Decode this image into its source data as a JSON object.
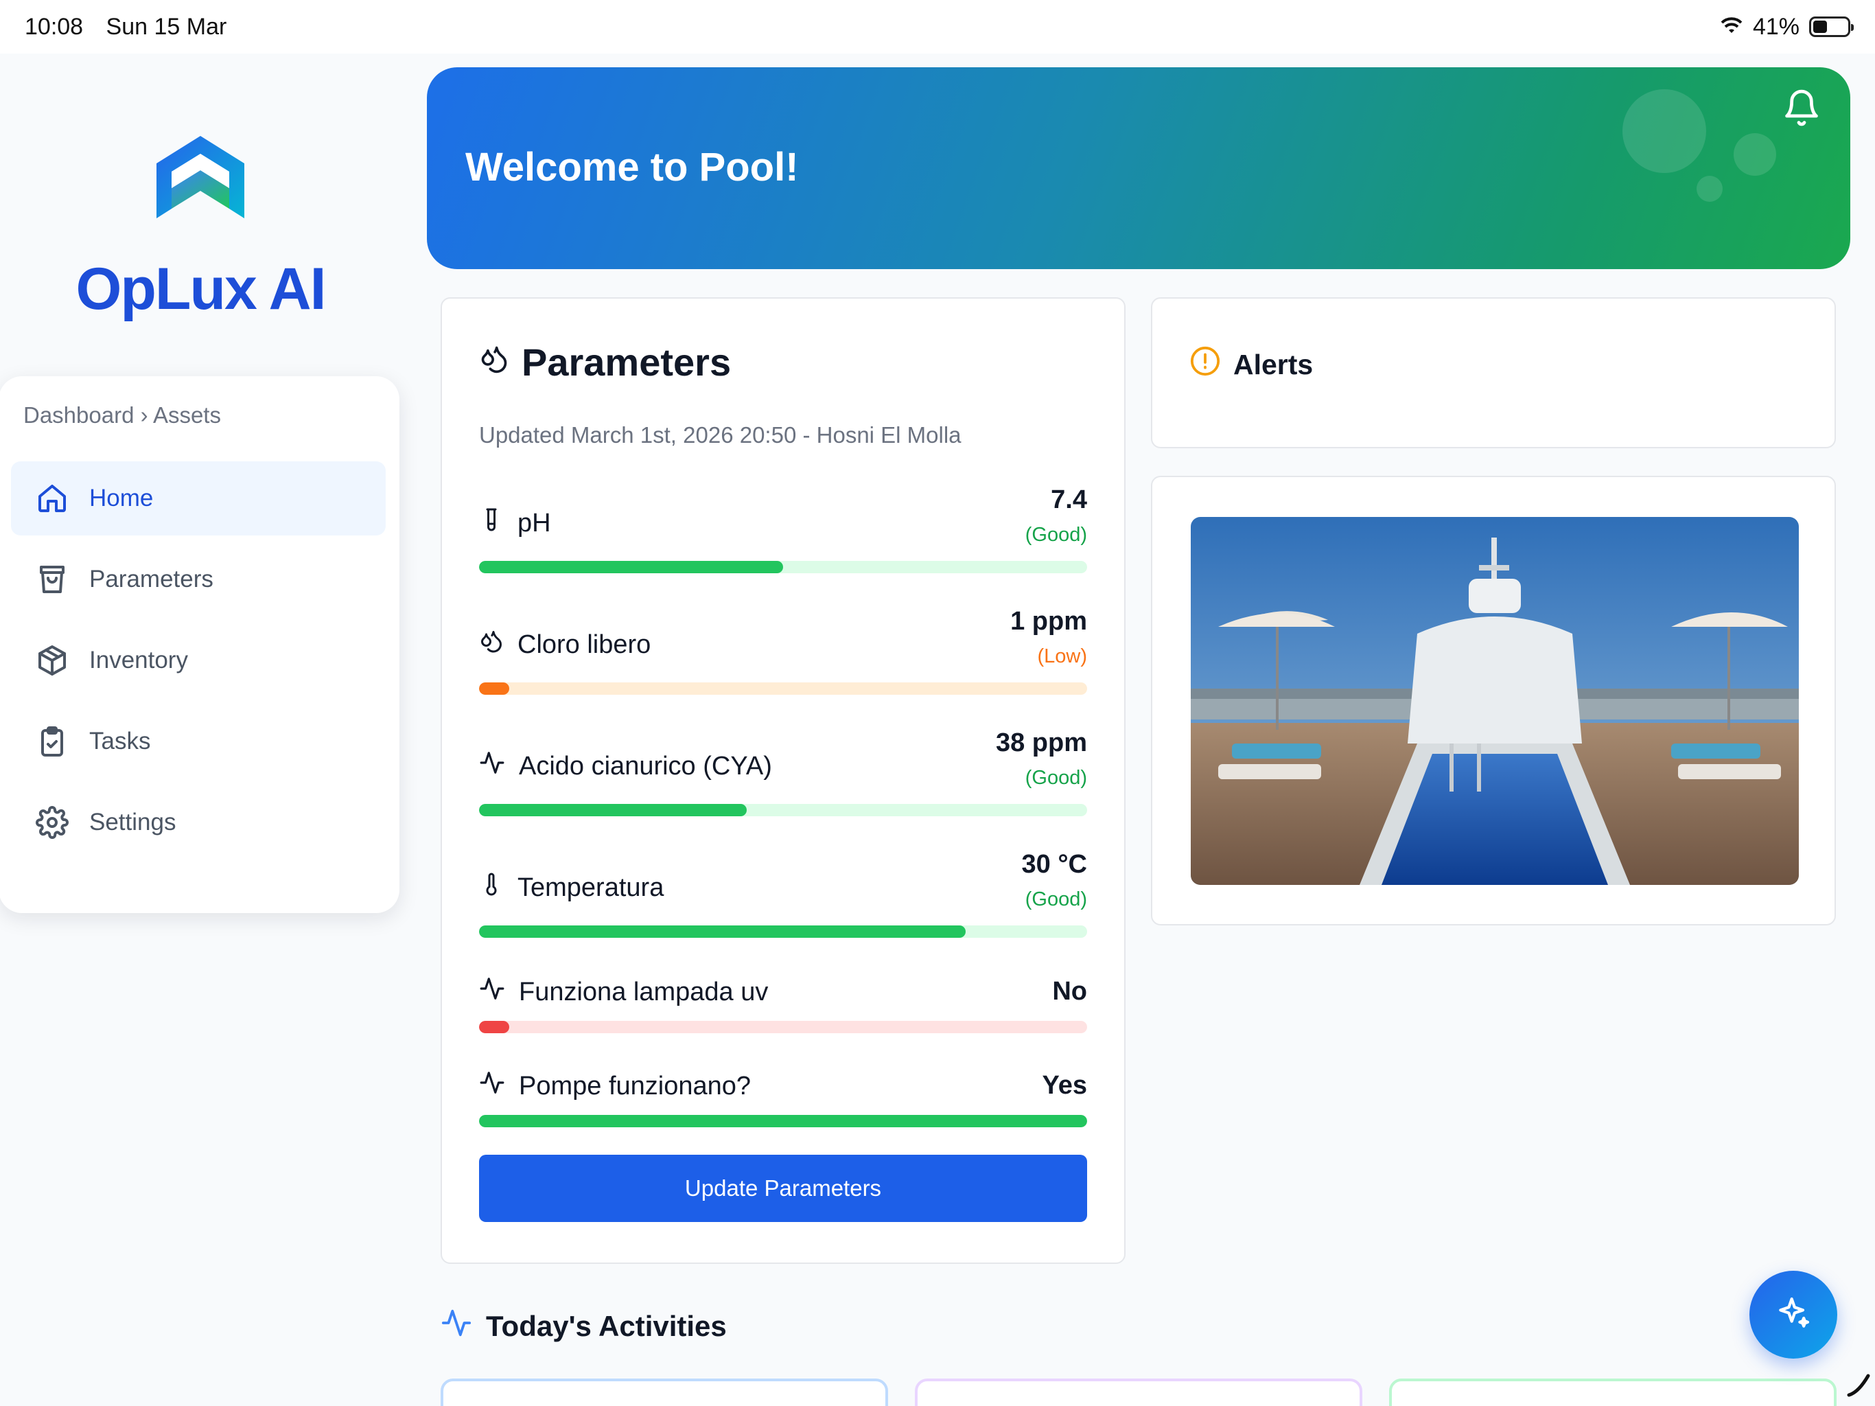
{
  "status_bar": {
    "time": "10:08",
    "date": "Sun 15 Mar",
    "battery": "41%",
    "battery_level": 0.41
  },
  "sidebar": {
    "brand": "OpLux AI",
    "breadcrumb": "Dashboard › Assets",
    "items": [
      {
        "label": "Home",
        "icon": "home-icon",
        "active": true
      },
      {
        "label": "Parameters",
        "icon": "shopping-bag-icon",
        "active": false
      },
      {
        "label": "Inventory",
        "icon": "package-icon",
        "active": false
      },
      {
        "label": "Tasks",
        "icon": "clipboard-check-icon",
        "active": false
      },
      {
        "label": "Settings",
        "icon": "gear-icon",
        "active": false
      }
    ]
  },
  "banner": {
    "title": "Welcome to Pool!",
    "icon": "bell-icon"
  },
  "parameters": {
    "title": "Parameters",
    "icon": "droplets-icon",
    "updated": "Updated March 1st, 2026 20:50 - Hosni El Molla",
    "rows": [
      {
        "label": "pH",
        "icon": "test-tube-icon",
        "value": "7.4",
        "status": "(Good)",
        "level": 0.5
      },
      {
        "label": "Cloro libero",
        "icon": "droplets-icon",
        "value": "1 ppm",
        "status": "(Low)",
        "level": 0.05
      },
      {
        "label": "Acido cianurico (CYA)",
        "icon": "activity-icon",
        "value": "38 ppm",
        "status": "(Good)",
        "level": 0.44
      },
      {
        "label": "Temperatura",
        "icon": "thermometer-icon",
        "value": "30 °C",
        "status": "(Good)",
        "level": 0.8
      },
      {
        "label": "Funziona lampada uv",
        "icon": "activity-icon",
        "value": "No",
        "status": "",
        "level": 0.05
      },
      {
        "label": "Pompe funzionano?",
        "icon": "activity-icon",
        "value": "Yes",
        "status": "",
        "level": 1.0
      }
    ],
    "button": "Update Parameters"
  },
  "alerts": {
    "title": "Alerts",
    "icon": "alert-circle-icon"
  },
  "activities": {
    "title": "Today's Activities",
    "icon": "activity-icon"
  },
  "fab": {
    "icon": "sparkles-icon"
  },
  "colors": {
    "primary": "#1d5fe8",
    "good": "#22c55e",
    "good_text": "#16a34a",
    "low": "#f97316",
    "bad": "#ef4444"
  }
}
